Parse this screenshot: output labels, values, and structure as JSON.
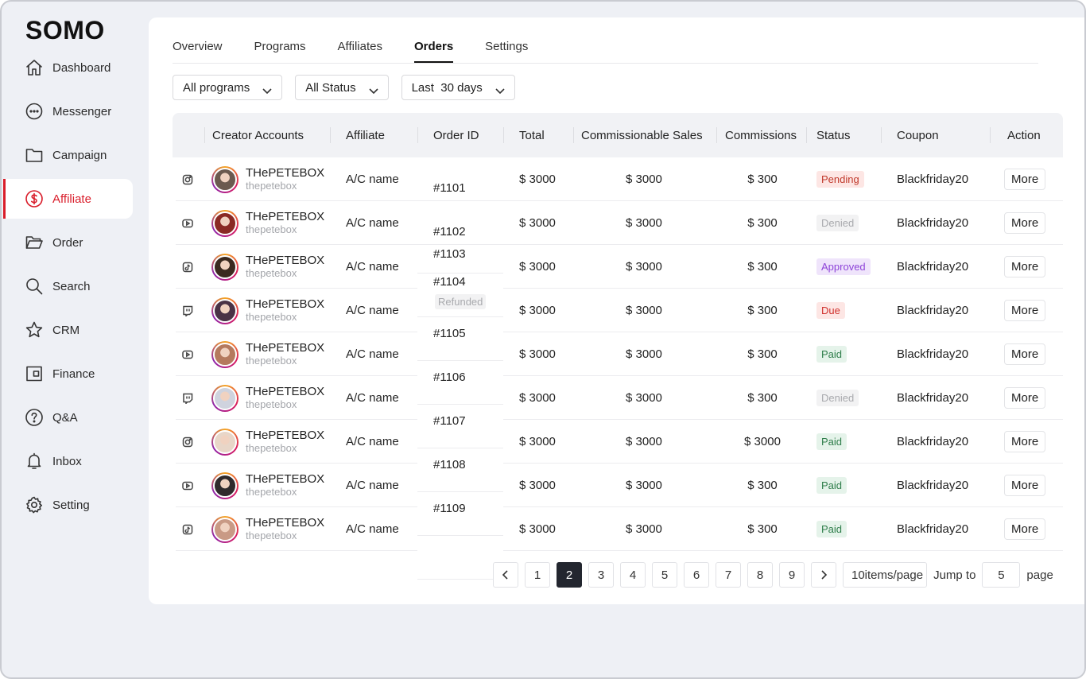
{
  "brand": "SOMO",
  "sidebar": {
    "items": [
      {
        "label": "Dashboard",
        "icon": "home-icon"
      },
      {
        "label": "Messenger",
        "icon": "chat-icon"
      },
      {
        "label": "Campaign",
        "icon": "folder-icon"
      },
      {
        "label": "Affiliate",
        "icon": "dollar-circle-icon",
        "active": true
      },
      {
        "label": "Order",
        "icon": "open-folder-icon"
      },
      {
        "label": "Search",
        "icon": "search-icon"
      },
      {
        "label": "CRM",
        "icon": "star-icon"
      },
      {
        "label": "Finance",
        "icon": "wallet-icon"
      },
      {
        "label": "Q&A",
        "icon": "question-icon"
      },
      {
        "label": "Inbox",
        "icon": "bell-icon"
      },
      {
        "label": "Setting",
        "icon": "gear-icon"
      }
    ]
  },
  "tabs": [
    "Overview",
    "Programs",
    "Affiliates",
    "Orders",
    "Settings"
  ],
  "active_tab": "Orders",
  "filters": {
    "program": "All programs",
    "status": "All Status",
    "period": "Last  30 days"
  },
  "table": {
    "headers": [
      "Creator Accounts",
      "Affiliate",
      "Order ID",
      "Total",
      "Commissionable Sales",
      "Commissions",
      "Status",
      "Coupon",
      "Action"
    ],
    "rows": [
      {
        "platform": "instagram-icon",
        "name": "THePETEBOX",
        "handle": "thepetebox",
        "affiliate": "A/C name",
        "order_id": "#1101",
        "total": "$ 3000",
        "sales": "$ 3000",
        "commission": "$ 300",
        "status": "Pending",
        "coupon": "Blackfriday20",
        "action": "More",
        "avatar_color": "#6b5a4f"
      },
      {
        "platform": "youtube-icon",
        "name": "THePETEBOX",
        "handle": "thepetebox",
        "affiliate": "A/C name",
        "order_id": "#1102",
        "total": "$ 3000",
        "sales": "$ 3000",
        "commission": "$ 300",
        "status": "Denied",
        "coupon": "Blackfriday20",
        "action": "More",
        "avatar_color": "#8a2a24"
      },
      {
        "platform": "tiktok-icon",
        "name": "THePETEBOX",
        "handle": "thepetebox",
        "affiliate": "A/C name",
        "order_id": "#1103",
        "total": "$ 3000",
        "sales": "$ 3000",
        "commission": "$ 300",
        "status": "Approved",
        "coupon": "Blackfriday20",
        "action": "More",
        "avatar_color": "#3b2a20"
      },
      {
        "platform": "twitch-icon",
        "name": "THePETEBOX",
        "handle": "thepetebox",
        "affiliate": "A/C name",
        "order_id": "#1104",
        "order_tag": "Refunded",
        "total": "$ 3000",
        "sales": "$ 3000",
        "commission": "$ 300",
        "status": "Due",
        "coupon": "Blackfriday20",
        "action": "More",
        "avatar_color": "#4a3346"
      },
      {
        "platform": "youtube-icon",
        "name": "THePETEBOX",
        "handle": "thepetebox",
        "affiliate": "A/C name",
        "order_id": "#1105",
        "total": "$ 3000",
        "sales": "$ 3000",
        "commission": "$ 300",
        "status": "Paid",
        "coupon": "Blackfriday20",
        "action": "More",
        "avatar_color": "#b57a5e"
      },
      {
        "platform": "twitch-icon",
        "name": "THePETEBOX",
        "handle": "thepetebox",
        "affiliate": "A/C name",
        "order_id": "#1106",
        "total": "$ 3000",
        "sales": "$ 3000",
        "commission": "$ 300",
        "status": "Denied",
        "coupon": "Blackfriday20",
        "action": "More",
        "avatar_color": "#cfd3de"
      },
      {
        "platform": "instagram-icon",
        "name": "THePETEBOX",
        "handle": "thepetebox",
        "affiliate": "A/C name",
        "order_id": "#1107",
        "total": "$ 3000",
        "sales": "$ 3000",
        "commission": "$ 3000",
        "status": "Paid",
        "coupon": "Blackfriday20",
        "action": "More",
        "avatar_color": "#e8d6c8"
      },
      {
        "platform": "youtube-icon",
        "name": "THePETEBOX",
        "handle": "thepetebox",
        "affiliate": "A/C name",
        "order_id": "#1108",
        "total": "$ 3000",
        "sales": "$ 3000",
        "commission": "$ 300",
        "status": "Paid",
        "coupon": "Blackfriday20",
        "action": "More",
        "avatar_color": "#2f2a2c"
      },
      {
        "platform": "tiktok-icon",
        "name": "THePETEBOX",
        "handle": "thepetebox",
        "affiliate": "A/C name",
        "order_id": "#1109",
        "total": "$ 3000",
        "sales": "$ 3000",
        "commission": "$ 300",
        "status": "Paid",
        "coupon": "Blackfriday20",
        "action": "More",
        "avatar_color": "#c99a85"
      }
    ]
  },
  "pagination": {
    "pages": [
      "1",
      "2",
      "3",
      "4",
      "5",
      "6",
      "7",
      "8",
      "9"
    ],
    "current": "2",
    "per_page": "10items/page",
    "jump_label": "Jump to",
    "jump_value": "5",
    "page_label": "page"
  },
  "colors": {
    "accent": "#d91d2a",
    "dark": "#23262f",
    "background": "#eef0f5"
  }
}
